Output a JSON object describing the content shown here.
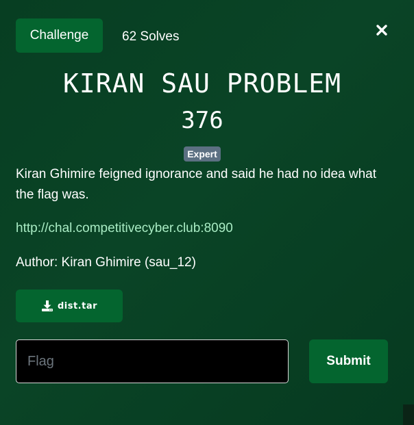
{
  "tabs": {
    "challenge_label": "Challenge",
    "solves_label": "62 Solves"
  },
  "challenge": {
    "name": "KIRAN SAU PROBLEM",
    "points": "376",
    "difficulty": "Expert",
    "description": "Kiran Ghimire feigned ignorance and said he had no idea what the flag was.",
    "link": "http://chal.competitivecyber.club:8090",
    "author": "Author: Kiran Ghimire (sau_12)"
  },
  "files": {
    "download_label": "dist.tar",
    "icon": "download-icon"
  },
  "form": {
    "flag_placeholder": "Flag",
    "flag_value": "",
    "submit_label": "Submit"
  },
  "colors": {
    "accent_green": "#04652f",
    "link_color": "#a9ecc4",
    "badge_color": "#5c7082"
  }
}
